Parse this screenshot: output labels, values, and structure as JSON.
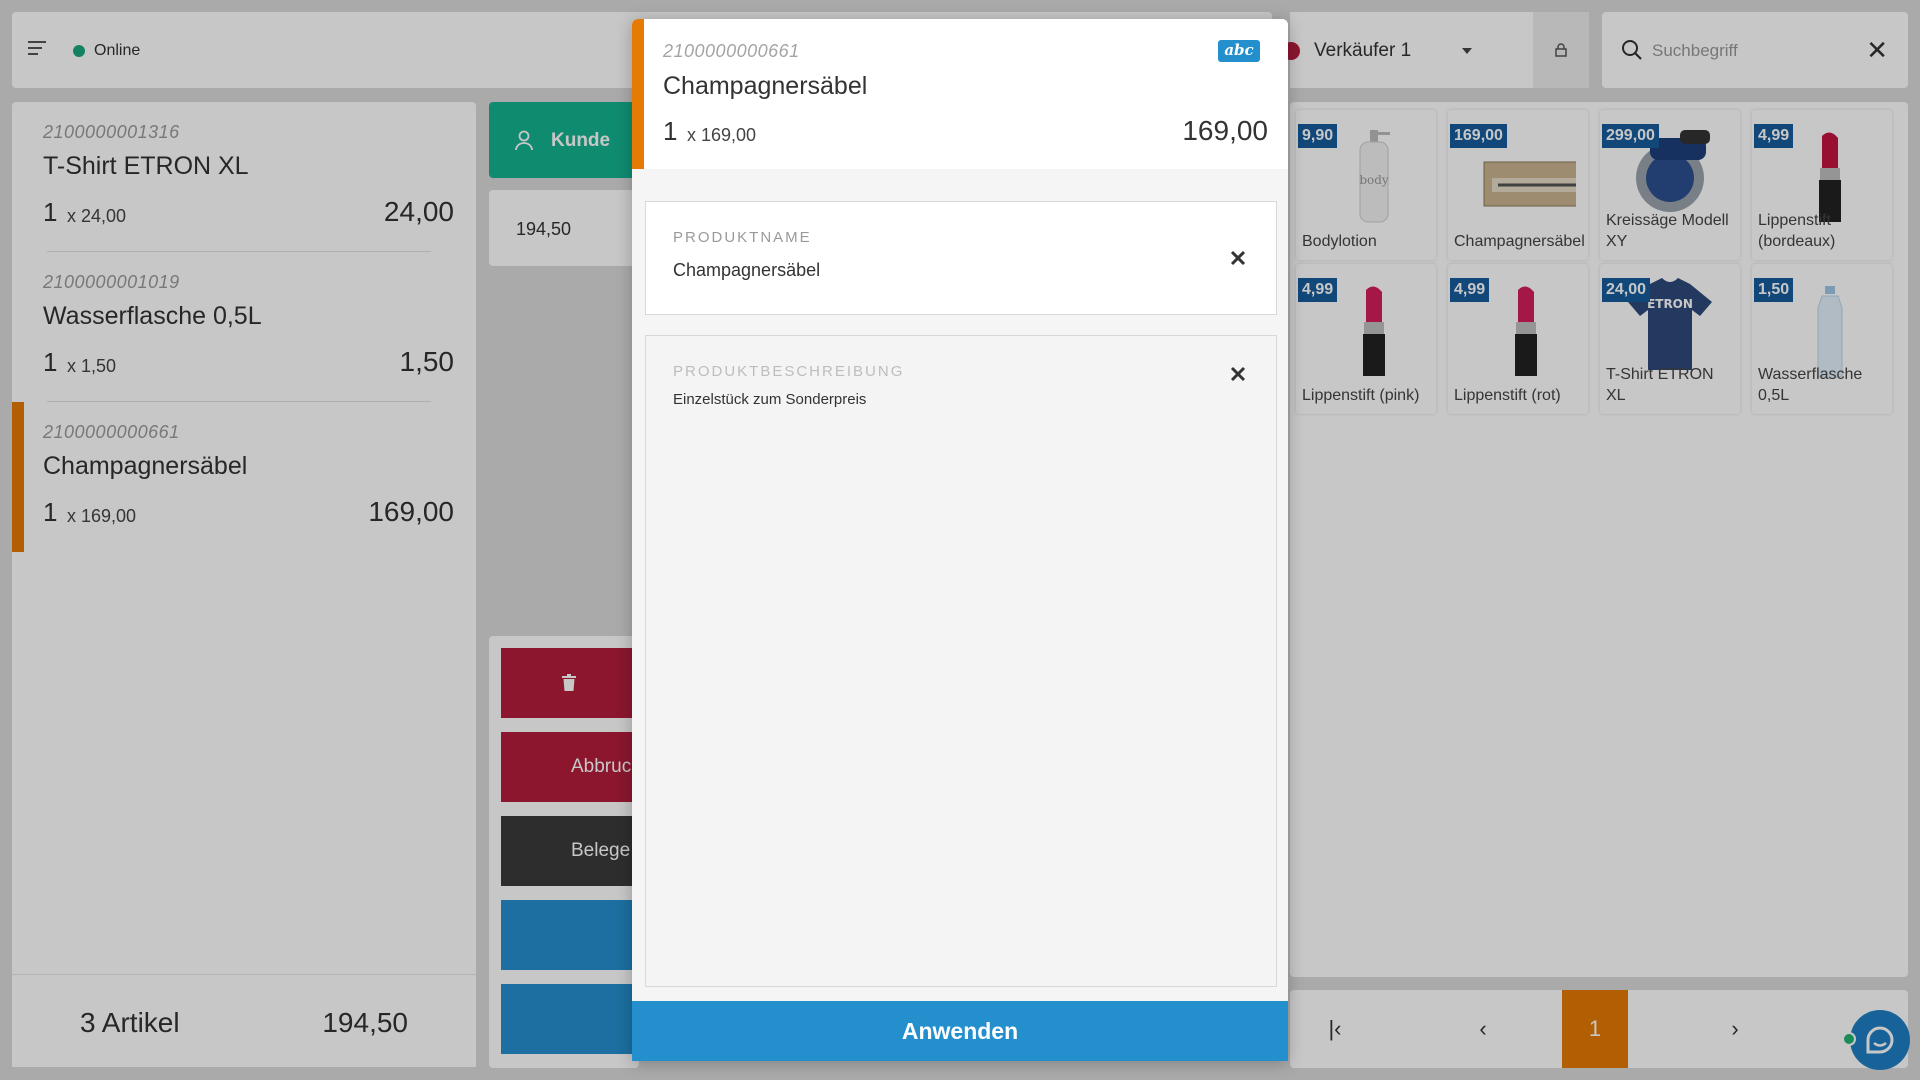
{
  "topbar": {
    "status_label": "Online",
    "seller_name": "Verkäufer 1",
    "search_placeholder": "Suchbegriff"
  },
  "cart": {
    "items": [
      {
        "sku": "2100000001316",
        "name": "T-Shirt ETRON XL",
        "qty": "1",
        "unit": "x 24,00",
        "total": "24,00"
      },
      {
        "sku": "2100000001019",
        "name": "Wasserflasche 0,5L",
        "qty": "1",
        "unit": "x 1,50",
        "total": "1,50"
      },
      {
        "sku": "2100000000661",
        "name": "Champagnersäbel",
        "qty": "1",
        "unit": "x 169,00",
        "total": "169,00",
        "selected": true
      }
    ],
    "footer": {
      "count": "3 Artikel",
      "sum": "194,50"
    }
  },
  "middle": {
    "customer_label": "Kunde",
    "subtotal": "194,50",
    "actions": {
      "abort": "Abbruc",
      "receipt": "Belege"
    }
  },
  "products": [
    {
      "price": "9,90",
      "name": "Bodylotion",
      "icon": "lotion-bottle-image"
    },
    {
      "price": "169,00",
      "name": "Champagnersäbel",
      "icon": "saber-box-image"
    },
    {
      "price": "299,00",
      "name": "Kreissäge Modell XY",
      "icon": "circular-saw-image"
    },
    {
      "price": "4,99",
      "name": "Lippenstift (bordeaux)",
      "icon": "lipstick-image"
    },
    {
      "price": "4,99",
      "name": "Lippenstift (pink)",
      "icon": "lipstick-image"
    },
    {
      "price": "4,99",
      "name": "Lippenstift (rot)",
      "icon": "lipstick-image"
    },
    {
      "price": "24,00",
      "name": "T-Shirt ETRON XL",
      "icon": "tshirt-image"
    },
    {
      "price": "1,50",
      "name": "Wasserflasche 0,5L",
      "icon": "water-bottle-image"
    }
  ],
  "pager": {
    "current_page": "1"
  },
  "modal": {
    "sku": "2100000000661",
    "name": "Champagnersäbel",
    "qty": "1",
    "unit": "x 169,00",
    "total": "169,00",
    "badge": "abc",
    "fields": {
      "name_label": "Produktname",
      "name_value": "Champagnersäbel",
      "desc_label": "Produktbeschreibung",
      "desc_value": "Einzelstück zum Sonderpreis"
    },
    "apply_label": "Anwenden"
  },
  "colors": {
    "accent_orange": "#e57a05",
    "primary_blue": "#248fcd",
    "danger_red": "#b31d3b",
    "customer_green": "#14b38f",
    "price_badge_blue": "#175d9c"
  }
}
